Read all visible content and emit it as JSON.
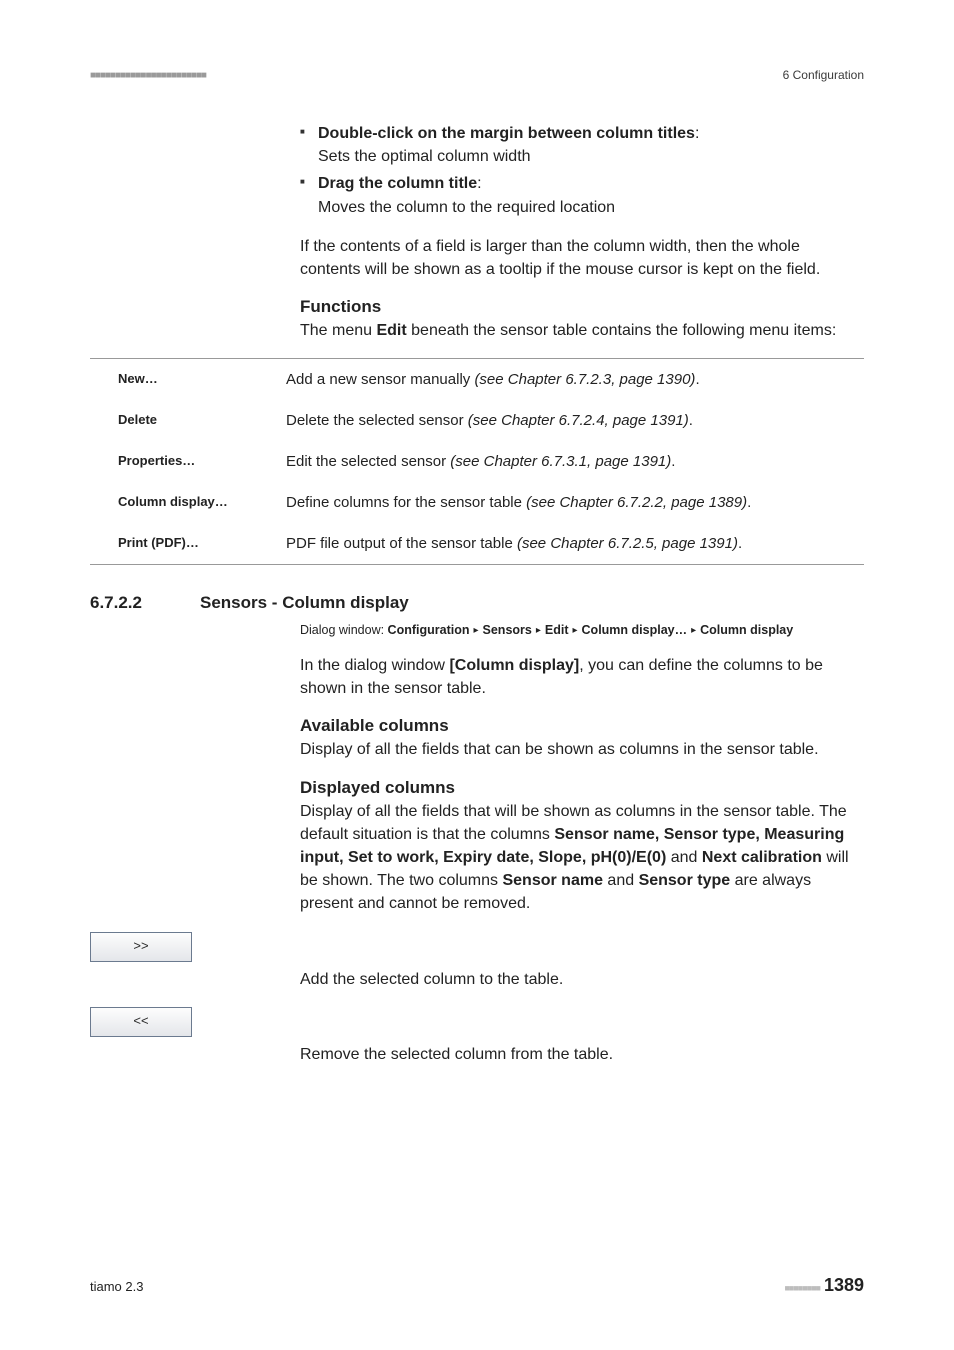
{
  "header": {
    "dots": "■■■■■■■■■■■■■■■■■■■■■■■",
    "right": "6 Configuration"
  },
  "bullets": [
    {
      "bold": "Double-click on the margin between column titles",
      "plain": ":\nSets the optimal column width"
    },
    {
      "bold": "Drag the column title",
      "plain": ":\nMoves the column to the required location"
    }
  ],
  "tooltip_para": "If the contents of a field is larger than the column width, then the whole contents will be shown as a tooltip if the mouse cursor is kept on the field.",
  "functions": {
    "heading": "Functions",
    "intro_pre": "The menu ",
    "intro_bold": "Edit",
    "intro_post": " beneath the sensor table contains the following menu items:",
    "rows": [
      {
        "label": "New…",
        "desc_pre": "Add a new sensor manually ",
        "desc_ref": "(see Chapter 6.7.2.3, page 1390)",
        "desc_post": "."
      },
      {
        "label": "Delete",
        "desc_pre": "Delete the selected sensor ",
        "desc_ref": "(see Chapter 6.7.2.4, page 1391)",
        "desc_post": "."
      },
      {
        "label": "Properties…",
        "desc_pre": "Edit the selected sensor ",
        "desc_ref": "(see Chapter 6.7.3.1, page 1391)",
        "desc_post": "."
      },
      {
        "label": "Column display…",
        "desc_pre": "Define columns for the sensor table ",
        "desc_ref": "(see Chapter 6.7.2.2, page 1389)",
        "desc_post": "."
      },
      {
        "label": "Print (PDF)…",
        "desc_pre": "PDF file output of the sensor table ",
        "desc_ref": "(see Chapter 6.7.2.5, page 1391)",
        "desc_post": "."
      }
    ]
  },
  "section": {
    "num": "6.7.2.2",
    "title": "Sensors - Column display",
    "breadcrumb_label": "Dialog window: ",
    "breadcrumb": [
      "Configuration",
      "Sensors",
      "Edit",
      "Column display…",
      "Column display"
    ],
    "intro_pre": "In the dialog window ",
    "intro_bold": "[Column display]",
    "intro_post": ", you can define the columns to be shown in the sensor table.",
    "available_heading": "Available columns",
    "available_text": "Display of all the fields that can be shown as columns in the sensor table.",
    "displayed_heading": "Displayed columns",
    "displayed_p1_pre": "Display of all the fields that will be shown as columns in the sensor table. The default situation is that the columns ",
    "displayed_p1_b1": "Sensor name, Sensor type, Measuring input, Set to work, Expiry date, Slope, pH(0)/E(0)",
    "displayed_p1_mid": " and ",
    "displayed_p1_b2": "Next calibration",
    "displayed_p1_mid2": " will be shown. The two columns ",
    "displayed_p1_b3": "Sensor name",
    "displayed_p1_mid3": " and ",
    "displayed_p1_b4": "Sensor type",
    "displayed_p1_post": " are always present and cannot be removed.",
    "btn_add_label": ">>",
    "btn_add_desc": "Add the selected column to the table.",
    "btn_remove_label": "<<",
    "btn_remove_desc": "Remove the selected column from the table."
  },
  "footer": {
    "left": "tiamo 2.3",
    "dots": "■■■■■■■■",
    "page": "1389"
  }
}
